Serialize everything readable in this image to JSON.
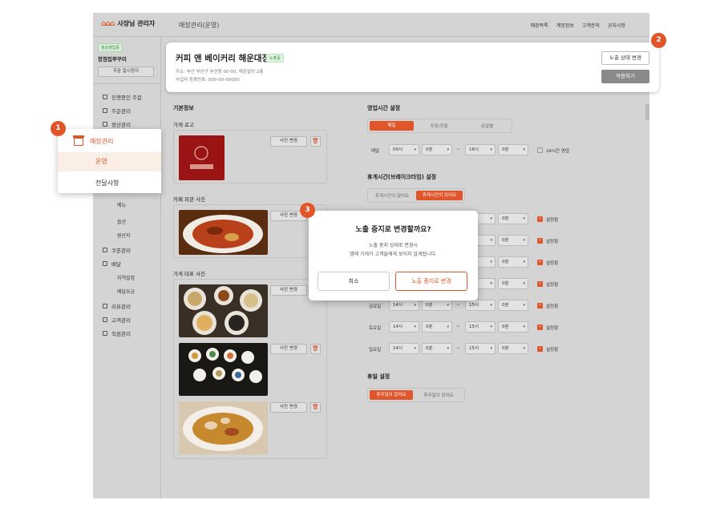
{
  "app": {
    "logo_mark": "🏠🏠🏠",
    "logo_text": "사장님 관리자",
    "breadcrumb": "매장관리(운영)",
    "topnav": [
      "매장목록",
      "계정정보",
      "고객문의",
      "공지사항"
    ]
  },
  "sidebar": {
    "status_badge": "정상영업중",
    "store_short": "장점집쭈꾸미",
    "pause_button": "주문 일시정지",
    "items": [
      "진행중인 주문",
      "주문관리",
      "정산관리"
    ],
    "sub_items_mid": [
      "메뉴",
      "옵션",
      "원산지"
    ],
    "items2": [
      "쿠폰관리",
      "배달"
    ],
    "delivery_sub": [
      "지역설정",
      "배달요금"
    ],
    "items3": [
      "리뷰관리",
      "고객관리",
      "직원관리"
    ]
  },
  "banner": {
    "store_name": "커피 앤 베이커리 해운대점",
    "exposure_badge": "노출중",
    "address": "주소: 부산 부산구 부산동 00-00, 해운빌딩 2층",
    "biz_number": "사업자 등록번호: 000-00-00000",
    "change_button": "노출 상태 변경",
    "apply_button": "적용하기"
  },
  "menu_popup": {
    "header": "매장관리",
    "selected": "운영",
    "other": "전달사항"
  },
  "callouts": [
    "1",
    "2",
    "3"
  ],
  "basic_info": {
    "title": "기본정보",
    "logo_label": "가게 로고",
    "exterior_label": "카페 외관 사진",
    "rep_label": "가게 대표 사진",
    "photo_change": "사진 변경",
    "trash_icon": "🗑"
  },
  "hours": {
    "title": "영업시간 설정",
    "tabs": [
      "매일",
      "주중/주말",
      "요일별"
    ],
    "active_tab": 0,
    "everyday_label": "매일",
    "start_hour": "09시",
    "start_min": "0분",
    "end_hour": "18시",
    "end_min": "0분",
    "tilde": "~",
    "allday_label": "24시간 영업"
  },
  "breaktime": {
    "title": "휴게시간(브레이크타임) 설정",
    "tabs": [
      "휴게시간이 없어요",
      "휴게시간이 있어요"
    ],
    "active_tab": 1,
    "check_label": "설정함",
    "rows": [
      {
        "day": "",
        "start_hour": "",
        "start_min": "",
        "end_hour": "",
        "end_min": "0분"
      },
      {
        "day": "",
        "start_hour": "",
        "start_min": "",
        "end_hour": "",
        "end_min": "0분"
      },
      {
        "day": "",
        "start_hour": "",
        "start_min": "",
        "end_hour": "",
        "end_min": "0분"
      },
      {
        "day": "",
        "start_hour": "",
        "start_min": "",
        "end_hour": "",
        "end_min": "0분"
      },
      {
        "day": "금요일",
        "start_hour": "14시",
        "start_min": "0분",
        "end_hour": "15시",
        "end_min": "0분"
      },
      {
        "day": "토요일",
        "start_hour": "14시",
        "start_min": "0분",
        "end_hour": "15시",
        "end_min": "0분"
      },
      {
        "day": "일요일",
        "start_hour": "14시",
        "start_min": "0분",
        "end_hour": "15시",
        "end_min": "0분"
      }
    ]
  },
  "holiday": {
    "title": "휴일 설정",
    "tabs": [
      "휴무일이 없어요",
      "휴무일이 있어요"
    ],
    "active_tab": 0
  },
  "modal": {
    "title": "노출 중지로 변경할까요?",
    "desc1": "노출 중지 상태로 변경시",
    "desc2": "앱에 가게가 고객들에게 보이지 않게됩니다.",
    "cancel": "취소",
    "confirm": "노출 중지로 변경"
  },
  "colors": {
    "accent": "#e0552a",
    "overlay_gray": "#d4d4d4"
  }
}
